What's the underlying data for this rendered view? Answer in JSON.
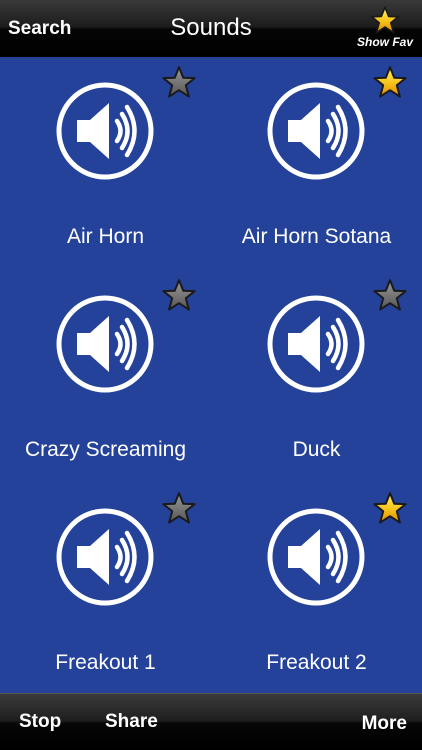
{
  "navbar": {
    "search_label": "Search",
    "title": "Sounds",
    "show_fav_label": "Show Fav"
  },
  "sounds": [
    {
      "label": "Air Horn",
      "favorite": false
    },
    {
      "label": "Air Horn Sotana",
      "favorite": true
    },
    {
      "label": "Crazy Screaming",
      "favorite": false
    },
    {
      "label": "Duck",
      "favorite": false
    },
    {
      "label": "Freakout 1",
      "favorite": false
    },
    {
      "label": "Freakout 2",
      "favorite": true
    }
  ],
  "toolbar": {
    "stop_label": "Stop",
    "share_label": "Share",
    "more_label": "More"
  },
  "colors": {
    "background": "#24429a",
    "favorite_on": "#f6c21a",
    "favorite_off": "#6e6e6e"
  },
  "icons": {
    "sound_button": "speaker-icon",
    "favorite": "star-icon"
  }
}
